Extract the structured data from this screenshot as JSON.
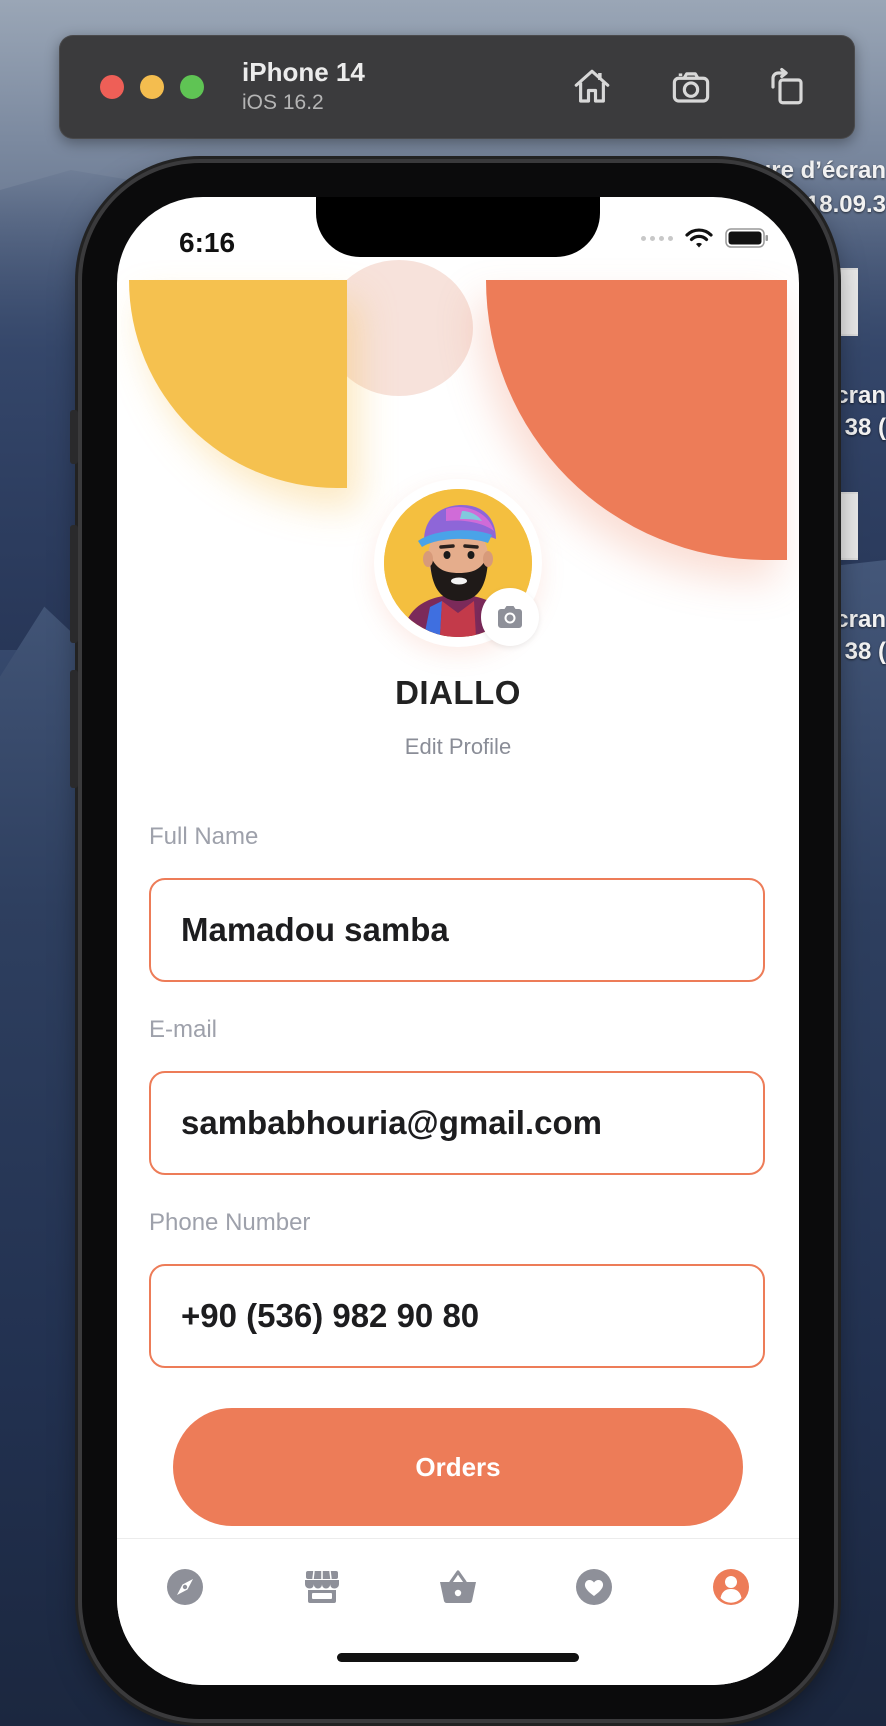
{
  "simulator": {
    "device_name": "iPhone 14",
    "os_version": "iOS 16.2",
    "buttons": {
      "home": "home-icon",
      "screenshot": "camera-icon",
      "rotate": "rotate-icon"
    }
  },
  "desktop": {
    "file_labels": [
      "ure d’écran",
      "18.09.3",
      "écran",
      "38 (",
      "cran",
      "38 ("
    ]
  },
  "status_bar": {
    "time": "6:16"
  },
  "profile": {
    "name": "DIALLO",
    "edit_label": "Edit Profile"
  },
  "form": {
    "full_name": {
      "label": "Full Name",
      "value": "Mamadou samba"
    },
    "email": {
      "label": "E-mail",
      "value": "sambabhouria@gmail.com"
    },
    "phone": {
      "label": "Phone Number",
      "value": "+90 (536) 982 90 80"
    }
  },
  "orders_button": {
    "label": "Orders"
  },
  "tab_bar": {
    "items": [
      {
        "icon": "compass-icon",
        "active": false
      },
      {
        "icon": "store-icon",
        "active": false
      },
      {
        "icon": "basket-icon",
        "active": false
      },
      {
        "icon": "heart-icon",
        "active": false
      },
      {
        "icon": "user-icon",
        "active": true
      }
    ]
  },
  "colors": {
    "accent": "#ed7c58",
    "yellow": "#f5c14f",
    "inactive_icon": "#8e9099",
    "text_dark": "#1d1d1f",
    "label_gray": "#9ea1ab"
  }
}
